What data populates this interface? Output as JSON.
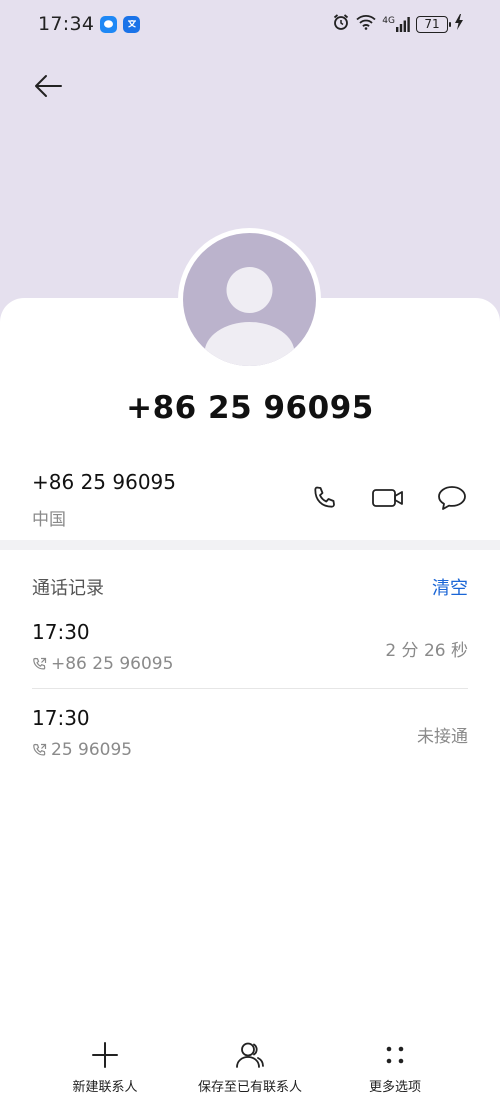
{
  "status_bar": {
    "time": "17:34",
    "network": "4G",
    "battery": "71"
  },
  "contact": {
    "title": "+86 25 96095",
    "number": "+86 25 96095",
    "location": "中国"
  },
  "call_log": {
    "heading": "通话记录",
    "clear_label": "清空",
    "entries": [
      {
        "time": "17:30",
        "number": "+86 25 96095",
        "status": "2 分 26 秒"
      },
      {
        "time": "17:30",
        "number": "25 96095",
        "status": "未接通"
      }
    ]
  },
  "bottom_bar": {
    "new_contact": "新建联系人",
    "save_existing": "保存至已有联系人",
    "more_options": "更多选项"
  },
  "colors": {
    "header_bg": "#e5e0ee",
    "avatar_bg": "#bbb3cc",
    "accent": "#1a65d6"
  },
  "icons": [
    "back-arrow-icon",
    "phone-icon",
    "video-call-icon",
    "message-icon",
    "plus-icon",
    "person-icon",
    "more-dots-icon"
  ]
}
